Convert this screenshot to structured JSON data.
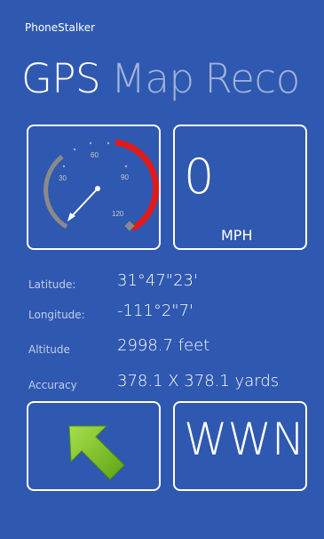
{
  "app": {
    "name": "PhoneStalker"
  },
  "pivot": {
    "items": [
      "GPS",
      "Map",
      "Reco"
    ],
    "active_index": 0
  },
  "gauge": {
    "ticks": [
      "30",
      "60",
      "90",
      "120"
    ],
    "reading_mph": 0,
    "max_mph": 120
  },
  "speed": {
    "value": "0",
    "unit": "MPH"
  },
  "location": {
    "latitude_label": "Latitude:",
    "latitude_value": "31°47\"23'",
    "longitude_label": "Longitude:",
    "longitude_value": "-111°2\"7'",
    "altitude_label": "Altitude",
    "altitude_value": "2998.7 feet",
    "accuracy_label": "Accuracy",
    "accuracy_value": "378.1 X 378.1 yards"
  },
  "direction": {
    "text": "WWN",
    "arrow_icon": "arrow-up-left-icon"
  },
  "colors": {
    "background": "#2f58b0",
    "arrow_green": "#7fc324",
    "gauge_red": "#e01a1a",
    "gauge_gray": "#8a8a8a"
  }
}
